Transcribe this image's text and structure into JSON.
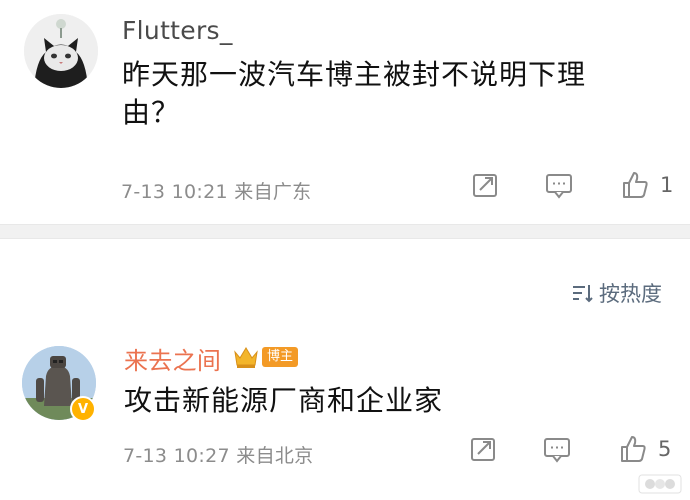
{
  "comments": [
    {
      "username": "Flutters_",
      "content": "昨天那一波汽车博主被封不说明下理由？",
      "time": "7-13 10:21",
      "location": "来自广东",
      "like_count": "1"
    },
    {
      "username": "来去之间",
      "role_badge": "博主",
      "content": "攻击新能源厂商和企业家",
      "time": "7-13 10:27",
      "location": "来自北京",
      "like_count": "5"
    }
  ],
  "sort": {
    "label": "按热度"
  },
  "colors": {
    "username_highlight": "#eb7350",
    "badge": "#f39a26",
    "verified": "#ffb200"
  }
}
